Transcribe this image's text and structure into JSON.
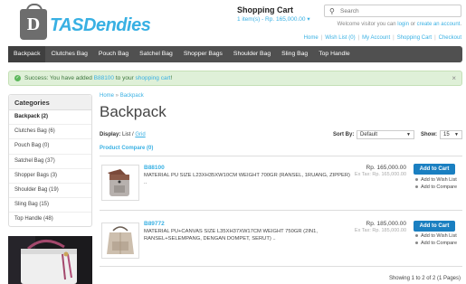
{
  "brand": {
    "logo_letter": "D",
    "name": "TASDendies"
  },
  "header": {
    "cart_title": "Shopping Cart",
    "cart_info": "1 item(s) - Rp. 165,000.00",
    "search_placeholder": "Search",
    "welcome_prefix": "Welcome visitor you can ",
    "login": "login",
    "or": " or ",
    "create_account": "create an account",
    "welcome_suffix": ".",
    "links": [
      "Home",
      "Wish List (0)",
      "My Account",
      "Shopping Cart",
      "Checkout"
    ]
  },
  "menu": [
    "Backpack",
    "Clutches Bag",
    "Pouch Bag",
    "Satchel Bag",
    "Shopper Bags",
    "Shoulder Bag",
    "Sling Bag",
    "Top Handle"
  ],
  "alert": {
    "prefix": "Success: You have added ",
    "product": "B88100",
    "middle": " to your ",
    "cart": "shopping cart",
    "suffix": "!",
    "close": "×"
  },
  "sidebar": {
    "title": "Categories",
    "items": [
      "Backpack (2)",
      "Clutches Bag (6)",
      "Pouch Bag (0)",
      "Satchel Bag (37)",
      "Shopper Bags (3)",
      "Shoulder Bag (19)",
      "Sling Bag (15)",
      "Top Handle (48)"
    ]
  },
  "breadcrumb": {
    "home": "Home",
    "sep": " » ",
    "current": "Backpack"
  },
  "page_title": "Backpack",
  "controls": {
    "display_label": "Display:",
    "list": "List",
    "grid_sep": " / ",
    "grid": "Grid",
    "sort_label": "Sort By:",
    "sort_value": "Default",
    "show_label": "Show:",
    "show_value": "15",
    "compare": "Product Compare (0)"
  },
  "products": [
    {
      "code": "B88100",
      "desc": "MATERIAL PU SIZE L23XH35XW10CM WEIGHT 700GR (RANSEL, 1RUANG, ZIPPER) ..",
      "price": "Rp. 165,000.00",
      "extax": "Ex Tax: Rp. 165,000.00",
      "add_to_cart": "Add to Cart",
      "wishlist": "Add to Wish List",
      "compare": "Add to Compare"
    },
    {
      "code": "B89772",
      "desc": "MATERIAL PU+CANVAS SIZE L35XH37XW17CM WEIGHT 750GR (2IN1, RANSEL+SELEMPANG, DENGAN DOMPET, SERUT) ..",
      "price": "Rp. 185,000.00",
      "extax": "Ex Tax: Rp. 185,000.00",
      "add_to_cart": "Add to Cart",
      "wishlist": "Add to Wish List",
      "compare": "Add to Compare"
    }
  ],
  "pagination": "Showing 1 to 2 of 2 (1 Pages)",
  "colors": {
    "accent": "#38B0E3",
    "menu_bg": "#505050",
    "button": "#1a7fc1",
    "success_bg": "#dff0d8"
  }
}
